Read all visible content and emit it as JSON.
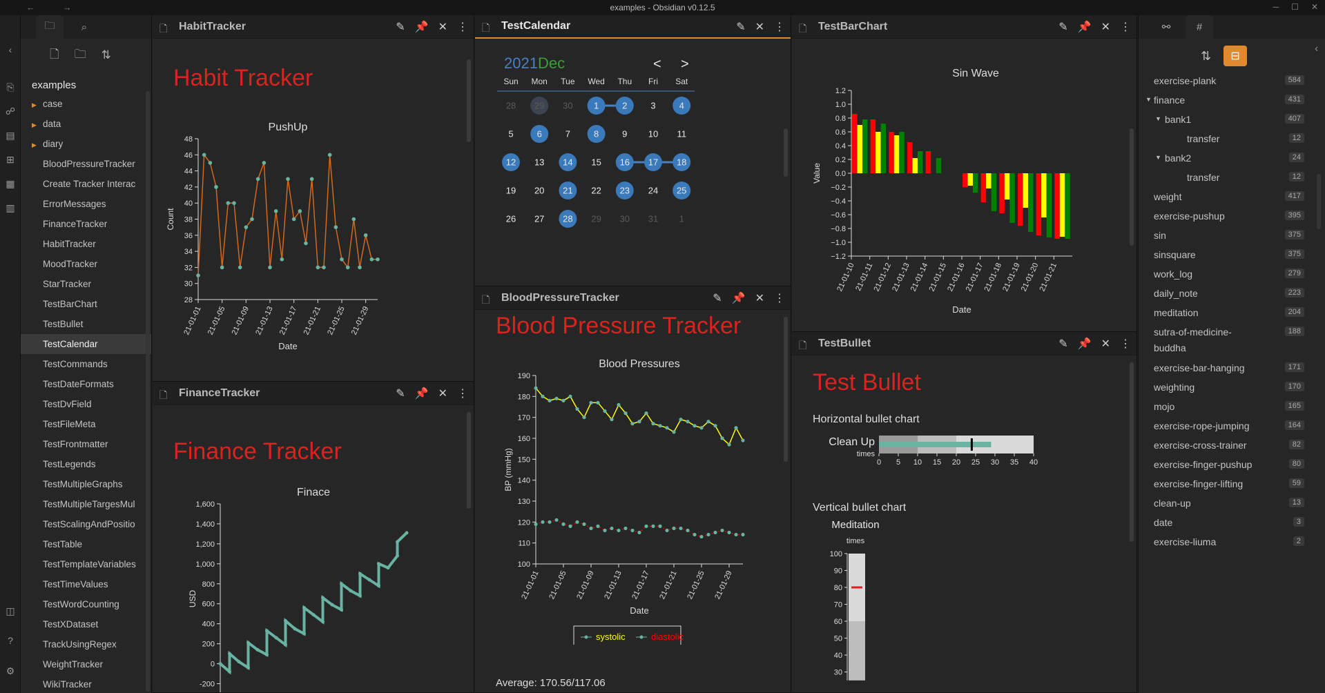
{
  "window": {
    "title": "examples - Obsidian v0.12.5"
  },
  "left": {
    "vault": "examples",
    "folders": [
      "case",
      "data",
      "diary"
    ],
    "files": [
      "BloodPressureTracker",
      "Create Tracker Interac",
      "ErrorMessages",
      "FinanceTracker",
      "HabitTracker",
      "MoodTracker",
      "StarTracker",
      "TestBarChart",
      "TestBullet",
      "TestCalendar",
      "TestCommands",
      "TestDateFormats",
      "TestDvField",
      "TestFileMeta",
      "TestFrontmatter",
      "TestLegends",
      "TestMultipleGraphs",
      "TestMultipleTargesMul",
      "TestScalingAndPositio",
      "TestTable",
      "TestTemplateVariables",
      "TestTimeValues",
      "TestWordCounting",
      "TestXDataset",
      "TrackUsingRegex",
      "WeightTracker",
      "WikiTracker"
    ],
    "active_file": "TestCalendar"
  },
  "habit": {
    "tab": "HabitTracker",
    "heading": "Habit Tracker",
    "chart_data": {
      "type": "line",
      "title": "PushUp",
      "xlabel": "Date",
      "ylabel": "Count",
      "ylim": [
        28,
        48
      ],
      "yticks": [
        28,
        30,
        32,
        34,
        36,
        38,
        40,
        42,
        44,
        46,
        48
      ],
      "xticks": [
        "21-01-01",
        "21-01-05",
        "21-01-09",
        "21-01-13",
        "21-01-17",
        "21-01-21",
        "21-01-25",
        "21-01-29"
      ],
      "x": [
        1,
        2,
        3,
        4,
        5,
        6,
        7,
        8,
        9,
        10,
        11,
        12,
        13,
        14,
        15,
        16,
        17,
        18,
        19,
        20,
        21,
        22,
        23,
        24,
        25,
        26,
        27,
        28,
        29,
        30,
        31
      ],
      "values": [
        31,
        46,
        45,
        42,
        32,
        40,
        40,
        32,
        37,
        38,
        43,
        45,
        32,
        39,
        33,
        43,
        38,
        39,
        35,
        43,
        32,
        32,
        46,
        37,
        33,
        32,
        38,
        32,
        36,
        33,
        33
      ],
      "color": "#d2691e"
    }
  },
  "finance": {
    "tab": "FinanceTracker",
    "heading": "Finance Tracker",
    "chart_data": {
      "type": "line",
      "title": "Finace",
      "ylabel": "USD",
      "ylim": [
        -300,
        1600
      ],
      "yticks": [
        "-200",
        "0",
        "200",
        "400",
        "600",
        "800",
        "1,000",
        "1,200",
        "1,400",
        "1,600"
      ],
      "ytick_values": [
        -200,
        0,
        200,
        400,
        600,
        800,
        1000,
        1200,
        1400,
        1600
      ],
      "x": [
        1,
        2,
        2,
        3,
        4,
        4,
        5,
        6,
        6,
        7,
        8,
        8,
        9,
        10,
        10,
        11,
        12,
        12,
        13,
        14,
        14,
        15,
        16,
        16,
        17,
        18,
        18,
        19,
        20,
        20,
        21
      ],
      "values": [
        0,
        -80,
        100,
        20,
        -40,
        210,
        140,
        90,
        330,
        260,
        190,
        430,
        350,
        300,
        560,
        490,
        420,
        660,
        590,
        540,
        800,
        730,
        680,
        900,
        840,
        780,
        1000,
        960,
        1080,
        1220,
        1310
      ],
      "color": "#69b3a2"
    }
  },
  "calendar": {
    "tab": "TestCalendar",
    "year": "2021",
    "month": "Dec",
    "prev": "<",
    "next": ">",
    "weekdays": [
      "Sun",
      "Mon",
      "Tue",
      "Wed",
      "Thu",
      "Fri",
      "Sat"
    ],
    "weeks": [
      [
        "28",
        "29",
        "30",
        "1",
        "2",
        "3",
        "4"
      ],
      [
        "5",
        "6",
        "7",
        "8",
        "9",
        "10",
        "11"
      ],
      [
        "12",
        "13",
        "14",
        "15",
        "16",
        "17",
        "18"
      ],
      [
        "19",
        "20",
        "21",
        "22",
        "23",
        "24",
        "25"
      ],
      [
        "26",
        "27",
        "28",
        "29",
        "30",
        "31",
        "1"
      ]
    ]
  },
  "bp": {
    "tab": "BloodPressureTracker",
    "heading": "Blood Pressure Tracker",
    "average": "Average: 170.56/117.06",
    "chart_data": {
      "type": "line",
      "title": "Blood Pressures",
      "xlabel": "Date",
      "ylabel": "BP (mmHg)",
      "ylim": [
        100,
        190
      ],
      "yticks": [
        100,
        110,
        120,
        130,
        140,
        150,
        160,
        170,
        180,
        190
      ],
      "xticks": [
        "21-01-01",
        "21-01-05",
        "21-01-09",
        "21-01-13",
        "21-01-17",
        "21-01-21",
        "21-01-25",
        "21-01-29"
      ],
      "series": [
        {
          "name": "systolic",
          "color": "#ffff00",
          "values": [
            184,
            180,
            178,
            179,
            178,
            180,
            174,
            170,
            177,
            177,
            173,
            169,
            176,
            172,
            167,
            168,
            172,
            167,
            166,
            165,
            163,
            169,
            168,
            166,
            165,
            168,
            166,
            160,
            157,
            165,
            159
          ]
        },
        {
          "name": "diastolic",
          "color": "#ff0000",
          "values": [
            119,
            120,
            120,
            121,
            119,
            118,
            120,
            119,
            117,
            118,
            116,
            117,
            116,
            117,
            116,
            115,
            118,
            118,
            118,
            116,
            117,
            117,
            116,
            114,
            113,
            114,
            115,
            116,
            115,
            114,
            114
          ]
        }
      ]
    }
  },
  "barchart": {
    "tab": "TestBarChart",
    "chart_data": {
      "type": "bar",
      "title": "Sin Wave",
      "xlabel": "Date",
      "ylabel": "Value",
      "ylim": [
        -1.2,
        1.2
      ],
      "yticks": [
        "−1.2",
        "−1.0",
        "−0.8",
        "−0.6",
        "−0.4",
        "−0.2",
        "0.0",
        "0.2",
        "0.4",
        "0.6",
        "0.8",
        "1.0",
        "1.2"
      ],
      "ytick_values": [
        -1.2,
        -1.0,
        -0.8,
        -0.6,
        -0.4,
        -0.2,
        0,
        0.2,
        0.4,
        0.6,
        0.8,
        1.0,
        1.2
      ],
      "xticks": [
        "21-01-10",
        "21-01-11",
        "21-01-12",
        "21-01-13",
        "21-01-14",
        "21-01-15",
        "21-01-16",
        "21-01-17",
        "21-01-18",
        "21-01-19",
        "21-01-20",
        "21-01-21"
      ],
      "groups": [
        [
          0.86,
          0.7,
          0.78
        ],
        [
          0.78,
          0.6,
          0.72
        ],
        [
          0.6,
          0.55,
          0.6
        ],
        [
          0.45,
          0.22,
          0.32
        ],
        [
          0.32,
          0,
          0.22
        ],
        [
          0,
          0,
          0
        ],
        [
          -0.2,
          -0.18,
          -0.28
        ],
        [
          -0.42,
          -0.22,
          -0.55
        ],
        [
          -0.58,
          -0.38,
          -0.72
        ],
        [
          -0.76,
          -0.5,
          -0.85
        ],
        [
          -0.9,
          -0.64,
          -0.93
        ],
        [
          -0.95,
          -0.92,
          -0.95
        ]
      ],
      "colors": [
        "#ff0000",
        "#ffff00",
        "#008000"
      ]
    }
  },
  "bullet": {
    "tab": "TestBullet",
    "heading": "Test Bullet",
    "horizontal_title": "Horizontal bullet chart",
    "vertical_title": "Vertical bullet chart",
    "horizontal": {
      "title": "Clean Up",
      "unit": "times",
      "range": [
        0,
        40
      ],
      "ticks": [
        "0",
        "5",
        "10",
        "15",
        "20",
        "25",
        "30",
        "35",
        "40"
      ],
      "value": 29,
      "target": 24,
      "bands": [
        10,
        20,
        40
      ]
    },
    "vertical": {
      "title": "Meditation",
      "unit": "times",
      "ticks": [
        "100",
        "90",
        "80",
        "70",
        "60",
        "50",
        "40",
        "30"
      ],
      "target": 80
    }
  },
  "tags": {
    "items": [
      {
        "name": "exercise-plank",
        "count": "584",
        "level": 0
      },
      {
        "name": "finance",
        "count": "431",
        "level": 0,
        "caret": true
      },
      {
        "name": "bank1",
        "count": "407",
        "level": 1,
        "caret": true
      },
      {
        "name": "transfer",
        "count": "12",
        "level": 2
      },
      {
        "name": "bank2",
        "count": "24",
        "level": 1,
        "caret": true
      },
      {
        "name": "transfer",
        "count": "12",
        "level": 2
      },
      {
        "name": "weight",
        "count": "417",
        "level": 0
      },
      {
        "name": "exercise-pushup",
        "count": "395",
        "level": 0
      },
      {
        "name": "sin",
        "count": "375",
        "level": 0
      },
      {
        "name": "sinsquare",
        "count": "375",
        "level": 0
      },
      {
        "name": "work_log",
        "count": "279",
        "level": 0
      },
      {
        "name": "daily_note",
        "count": "223",
        "level": 0
      },
      {
        "name": "meditation",
        "count": "204",
        "level": 0
      },
      {
        "name": "sutra-of-medicine-",
        "name2": "buddha",
        "count": "188",
        "level": 0
      },
      {
        "name": "exercise-bar-hanging",
        "count": "171",
        "level": 0
      },
      {
        "name": "weighting",
        "count": "170",
        "level": 0
      },
      {
        "name": "mojo",
        "count": "165",
        "level": 0
      },
      {
        "name": "exercise-rope-jumping",
        "count": "164",
        "level": 0
      },
      {
        "name": "exercise-cross-trainer",
        "count": "82",
        "level": 0
      },
      {
        "name": "exercise-finger-pushup",
        "count": "80",
        "level": 0
      },
      {
        "name": "exercise-finger-lifting",
        "count": "59",
        "level": 0
      },
      {
        "name": "clean-up",
        "count": "13",
        "level": 0
      },
      {
        "name": "date",
        "count": "3",
        "level": 0
      },
      {
        "name": "exercise-liuma",
        "count": "2",
        "level": 0
      }
    ]
  }
}
